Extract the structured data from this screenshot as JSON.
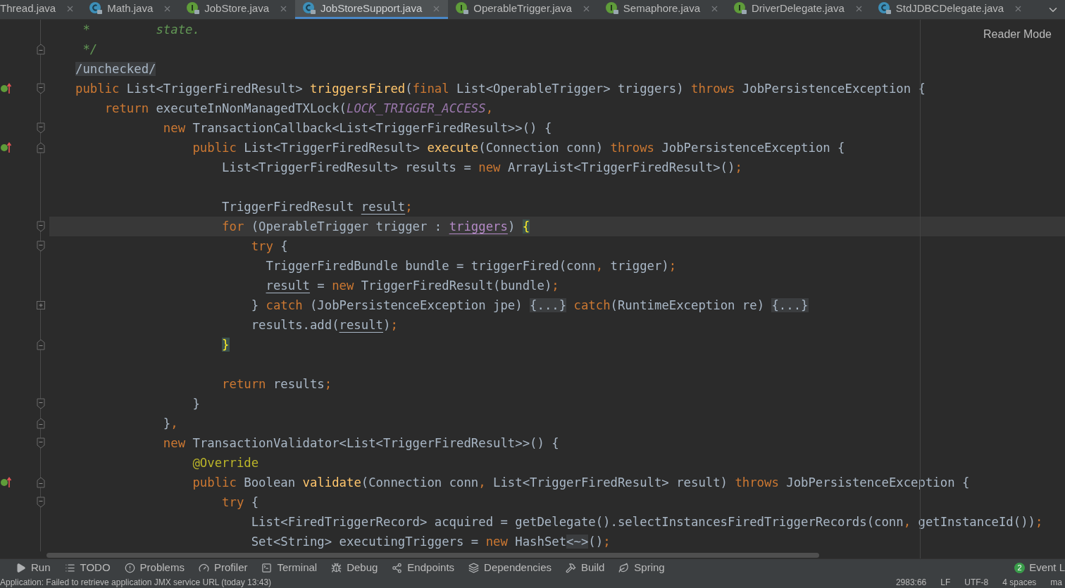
{
  "tabs": [
    {
      "label": "Thread.java",
      "kind": "file",
      "selected": false
    },
    {
      "label": "Math.java",
      "kind": "class",
      "selected": false
    },
    {
      "label": "JobStore.java",
      "kind": "interface",
      "selected": false
    },
    {
      "label": "JobStoreSupport.java",
      "kind": "class",
      "selected": true
    },
    {
      "label": "OperableTrigger.java",
      "kind": "interface",
      "selected": false
    },
    {
      "label": "Semaphore.java",
      "kind": "interface",
      "selected": false
    },
    {
      "label": "DriverDelegate.java",
      "kind": "interface",
      "selected": false
    },
    {
      "label": "StdJDBCDelegate.java",
      "kind": "class",
      "selected": false
    }
  ],
  "reader_mode": "Reader Mode",
  "code_lines": [
    {
      "current": false,
      "tokens": [
        {
          "kind": "comment",
          "text": " *         state."
        }
      ]
    },
    {
      "current": false,
      "fold_marker": {
        "kind": "end"
      },
      "tokens": [
        {
          "kind": "comment",
          "text": " */"
        }
      ]
    },
    {
      "current": false,
      "tokens": [
        {
          "kind": "folded",
          "text": "/unchecked/"
        }
      ]
    },
    {
      "current": false,
      "fold_marker": {
        "kind": "start"
      },
      "gutter_icon": {
        "kind": "implements"
      },
      "tokens": [
        {
          "kind": "keyword",
          "text": "public "
        },
        {
          "kind": "plain",
          "text": "List<TriggerFiredResult> "
        },
        {
          "kind": "method",
          "text": "triggersFired"
        },
        {
          "kind": "plain",
          "text": "("
        },
        {
          "kind": "keyword",
          "text": "final "
        },
        {
          "kind": "plain",
          "text": "List<OperableTrigger> triggers) "
        },
        {
          "kind": "keyword",
          "text": "throws "
        },
        {
          "kind": "plain",
          "text": "JobPersistenceException {"
        }
      ]
    },
    {
      "current": false,
      "tokens": [
        {
          "kind": "keyword",
          "text": "    return "
        },
        {
          "kind": "plain",
          "text": "executeInNonManagedTXLock("
        },
        {
          "kind": "constant",
          "text": "LOCK_TRIGGER_ACCESS"
        },
        {
          "kind": "punct",
          "text": ","
        }
      ]
    },
    {
      "current": false,
      "fold_marker": {
        "kind": "start"
      },
      "tokens": [
        {
          "kind": "keyword",
          "text": "            new "
        },
        {
          "kind": "plain",
          "text": "TransactionCallback<List<TriggerFiredResult>>() {"
        }
      ]
    },
    {
      "current": false,
      "fold_marker": {
        "kind": "end"
      },
      "gutter_icon": {
        "kind": "implements"
      },
      "tokens": [
        {
          "kind": "keyword",
          "text": "                public "
        },
        {
          "kind": "plain",
          "text": "List<TriggerFiredResult> "
        },
        {
          "kind": "method",
          "text": "execute"
        },
        {
          "kind": "plain",
          "text": "(Connection conn) "
        },
        {
          "kind": "keyword",
          "text": "throws "
        },
        {
          "kind": "plain",
          "text": "JobPersistenceException {"
        }
      ]
    },
    {
      "current": false,
      "tokens": [
        {
          "kind": "plain",
          "text": "                    List<TriggerFiredResult> results = "
        },
        {
          "kind": "keyword",
          "text": "new "
        },
        {
          "kind": "plain",
          "text": "ArrayList<TriggerFiredResult>()"
        },
        {
          "kind": "punct",
          "text": ";"
        }
      ]
    },
    {
      "current": false
    },
    {
      "current": false,
      "tokens": [
        {
          "kind": "plain",
          "text": "                    TriggerFiredResult "
        },
        {
          "kind": "variable",
          "text": "result"
        },
        {
          "kind": "punct",
          "text": ";"
        }
      ]
    },
    {
      "current": true,
      "fold_marker": {
        "kind": "start"
      },
      "tokens": [
        {
          "kind": "keyword",
          "text": "                    for "
        },
        {
          "kind": "plain",
          "text": "(OperableTrigger trigger : "
        },
        {
          "kind": "parameter",
          "text": "triggers"
        },
        {
          "kind": "plain",
          "text": ") "
        },
        {
          "kind": "brace",
          "text": "{"
        }
      ]
    },
    {
      "current": false,
      "fold_marker": {
        "kind": "start"
      },
      "tokens": [
        {
          "kind": "keyword",
          "text": "                        try "
        },
        {
          "kind": "plain",
          "text": "{"
        }
      ]
    },
    {
      "current": false,
      "tokens": [
        {
          "kind": "plain",
          "text": "                          TriggerFiredBundle bundle = triggerFired(conn"
        },
        {
          "kind": "punct",
          "text": ", "
        },
        {
          "kind": "plain",
          "text": "trigger)"
        },
        {
          "kind": "punct",
          "text": ";"
        }
      ]
    },
    {
      "current": false,
      "tokens": [
        {
          "kind": "variable",
          "text": "                          result"
        },
        {
          "kind": "plain",
          "text": " = "
        },
        {
          "kind": "keyword",
          "text": "new "
        },
        {
          "kind": "plain",
          "text": "TriggerFiredResult(bundle)"
        },
        {
          "kind": "punct",
          "text": ";"
        }
      ]
    },
    {
      "current": false,
      "fold_marker": {
        "kind": "collapsed"
      },
      "tokens": [
        {
          "kind": "plain",
          "text": "                        } "
        },
        {
          "kind": "keyword",
          "text": "catch "
        },
        {
          "kind": "plain",
          "text": "(JobPersistenceException jpe) "
        },
        {
          "kind": "folded",
          "text": "{...}"
        },
        {
          "kind": "keyword",
          "text": " catch"
        },
        {
          "kind": "plain",
          "text": "(RuntimeException re) "
        },
        {
          "kind": "folded",
          "text": "{...}"
        }
      ]
    },
    {
      "current": false,
      "tokens": [
        {
          "kind": "plain",
          "text": "                        results.add("
        },
        {
          "kind": "variable",
          "text": "result"
        },
        {
          "kind": "plain",
          "text": ")"
        },
        {
          "kind": "punct",
          "text": ";"
        }
      ]
    },
    {
      "current": false,
      "fold_marker": {
        "kind": "end"
      },
      "tokens": [
        {
          "kind": "brace",
          "text": "                    }"
        }
      ]
    },
    {
      "current": false
    },
    {
      "current": false,
      "tokens": [
        {
          "kind": "keyword",
          "text": "                    return "
        },
        {
          "kind": "plain",
          "text": "results"
        },
        {
          "kind": "punct",
          "text": ";"
        }
      ]
    },
    {
      "current": false,
      "fold_marker": {
        "kind": "start"
      },
      "tokens": [
        {
          "kind": "plain",
          "text": "                }"
        }
      ]
    },
    {
      "current": false,
      "fold_marker": {
        "kind": "end"
      },
      "tokens": [
        {
          "kind": "plain",
          "text": "            }"
        },
        {
          "kind": "punct",
          "text": ","
        }
      ]
    },
    {
      "current": false,
      "fold_marker": {
        "kind": "start"
      },
      "tokens": [
        {
          "kind": "keyword",
          "text": "            new "
        },
        {
          "kind": "plain",
          "text": "TransactionValidator<List<TriggerFiredResult>>() {"
        }
      ]
    },
    {
      "current": false,
      "tokens": [
        {
          "kind": "annotation",
          "text": "                @Override"
        }
      ]
    },
    {
      "current": false,
      "fold_marker": {
        "kind": "end"
      },
      "gutter_icon": {
        "kind": "implements"
      },
      "tokens": [
        {
          "kind": "keyword",
          "text": "                public "
        },
        {
          "kind": "plain",
          "text": "Boolean "
        },
        {
          "kind": "method",
          "text": "validate"
        },
        {
          "kind": "plain",
          "text": "(Connection conn"
        },
        {
          "kind": "punct",
          "text": ", "
        },
        {
          "kind": "plain",
          "text": "List<TriggerFiredResult> result) "
        },
        {
          "kind": "keyword",
          "text": "throws "
        },
        {
          "kind": "plain",
          "text": "JobPersistenceException {"
        }
      ]
    },
    {
      "current": false,
      "fold_marker": {
        "kind": "start"
      },
      "tokens": [
        {
          "kind": "keyword",
          "text": "                    try "
        },
        {
          "kind": "plain",
          "text": "{"
        }
      ]
    },
    {
      "current": false,
      "tokens": [
        {
          "kind": "plain",
          "text": "                        List<FiredTriggerRecord> acquired = getDelegate().selectInstancesFiredTriggerRecords(conn"
        },
        {
          "kind": "punct",
          "text": ", "
        },
        {
          "kind": "plain",
          "text": "getInstanceId())"
        },
        {
          "kind": "punct",
          "text": ";"
        }
      ]
    },
    {
      "current": false,
      "tokens": [
        {
          "kind": "plain",
          "text": "                        Set<String> executingTriggers = "
        },
        {
          "kind": "keyword",
          "text": "new "
        },
        {
          "kind": "plain",
          "text": "HashSet"
        },
        {
          "kind": "folded",
          "text": "<~>"
        },
        {
          "kind": "plain",
          "text": "()"
        },
        {
          "kind": "punct",
          "text": ";"
        }
      ]
    }
  ],
  "tool_windows": [
    {
      "label": "Run",
      "kind": "run"
    },
    {
      "label": "TODO",
      "kind": "list"
    },
    {
      "label": "Problems",
      "kind": "problems"
    },
    {
      "label": "Profiler",
      "kind": "profiler"
    },
    {
      "label": "Terminal",
      "kind": "terminal"
    },
    {
      "label": "Debug",
      "kind": "debug"
    },
    {
      "label": "Endpoints",
      "kind": "endpoints"
    },
    {
      "label": "Dependencies",
      "kind": "layers"
    },
    {
      "label": "Build",
      "kind": "build"
    },
    {
      "label": "Spring",
      "kind": "spring"
    }
  ],
  "event_log": {
    "count": "2",
    "label": "Event L"
  },
  "status": {
    "message": "Application: Failed to retrieve application JMX service URL (today 13:43)",
    "items": [
      "2983:66",
      "LF",
      "UTF-8",
      "4 spaces",
      "ma"
    ]
  }
}
